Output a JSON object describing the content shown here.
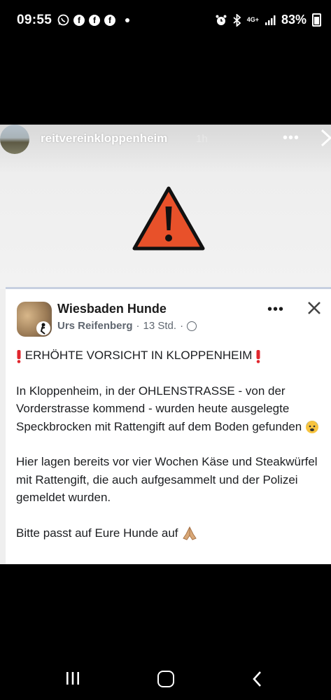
{
  "status_bar": {
    "time": "09:55",
    "network": "4G+",
    "battery": "83%",
    "icons": [
      "whatsapp-icon",
      "facebook-icon",
      "facebook-icon",
      "facebook-icon",
      "alarm-icon",
      "bluetooth-icon",
      "signal-icon",
      "battery-icon"
    ]
  },
  "story": {
    "username": "reitvereinkloppenheim",
    "time": "1h",
    "more": "•••"
  },
  "post": {
    "page_name": "Wiesbaden Hunde",
    "author": "Urs Reifenberg",
    "time": "13 Std.",
    "separator": "·",
    "more": "•••",
    "headline": "ERHÖHTE VORSICHT IN KLOPPENHEIM",
    "paragraph1": "In Kloppenheim, in der OHLENSTRASSE - von der Vorderstrasse kommend - wurden heute ausgelegte Speckbrocken mit Rattengift auf dem Boden gefunden",
    "paragraph2": "Hier lagen bereits vor vier Wochen Käse und Steakwürfel mit Rattengift, die auch aufgesammelt und der Polizei gemeldet wurden.",
    "paragraph3": "Bitte passt auf Eure Hunde auf"
  },
  "colors": {
    "warning_fill": "#e8512a",
    "exclamation": "#e0262d",
    "card_background": "#ffffff",
    "story_background": "#efefef"
  }
}
